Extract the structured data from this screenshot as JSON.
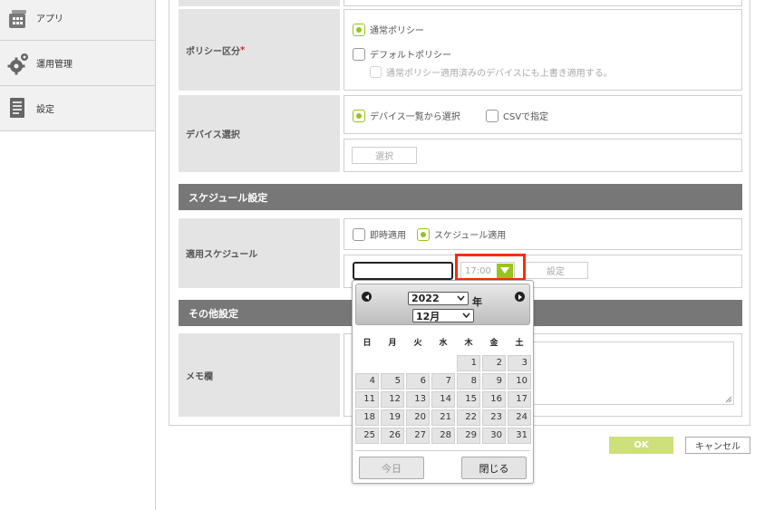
{
  "sidebar": {
    "items": [
      {
        "label": "アプリ",
        "icon": "app-grid-icon"
      },
      {
        "label": "運用管理",
        "icon": "gears-icon"
      },
      {
        "label": "設定",
        "icon": "document-icon"
      }
    ]
  },
  "policy": {
    "label": "ポリシー区分",
    "required_mark": "*",
    "option_normal": "通常ポリシー",
    "option_default": "デフォルトポリシー",
    "overwrite_note": "通常ポリシー適用済みのデバイスにも上書き適用する。"
  },
  "device": {
    "label": "デバイス選択",
    "option_list": "デバイス一覧から選択",
    "option_csv": "CSVで指定",
    "select_button": "選択"
  },
  "schedule_section": {
    "title": "スケジュール設定",
    "row_label": "適用スケジュール",
    "option_immediate": "即時適用",
    "option_schedule": "スケジュール適用",
    "date_value": "",
    "time_value": "17:00",
    "set_button": "設定"
  },
  "other_section": {
    "title": "その他設定",
    "memo_label": "メモ欄",
    "memo_value": ""
  },
  "footer": {
    "ok": "OK",
    "cancel": "キャンセル"
  },
  "calendar": {
    "year": "2022",
    "year_suffix": "年",
    "month": "12月",
    "weekdays": [
      "日",
      "月",
      "火",
      "水",
      "木",
      "金",
      "土"
    ],
    "weeks": [
      [
        "",
        "",
        "",
        "",
        "1",
        "2",
        "3"
      ],
      [
        "4",
        "5",
        "6",
        "7",
        "8",
        "9",
        "10"
      ],
      [
        "11",
        "12",
        "13",
        "14",
        "15",
        "16",
        "17"
      ],
      [
        "18",
        "19",
        "20",
        "21",
        "22",
        "23",
        "24"
      ],
      [
        "25",
        "26",
        "27",
        "28",
        "29",
        "30",
        "31"
      ]
    ],
    "today_button": "今日",
    "close_button": "閉じる"
  },
  "colors": {
    "accent": "#9ac31c",
    "section_bar": "#777777",
    "highlight": "#ff2a00",
    "required": "#d9232d"
  }
}
